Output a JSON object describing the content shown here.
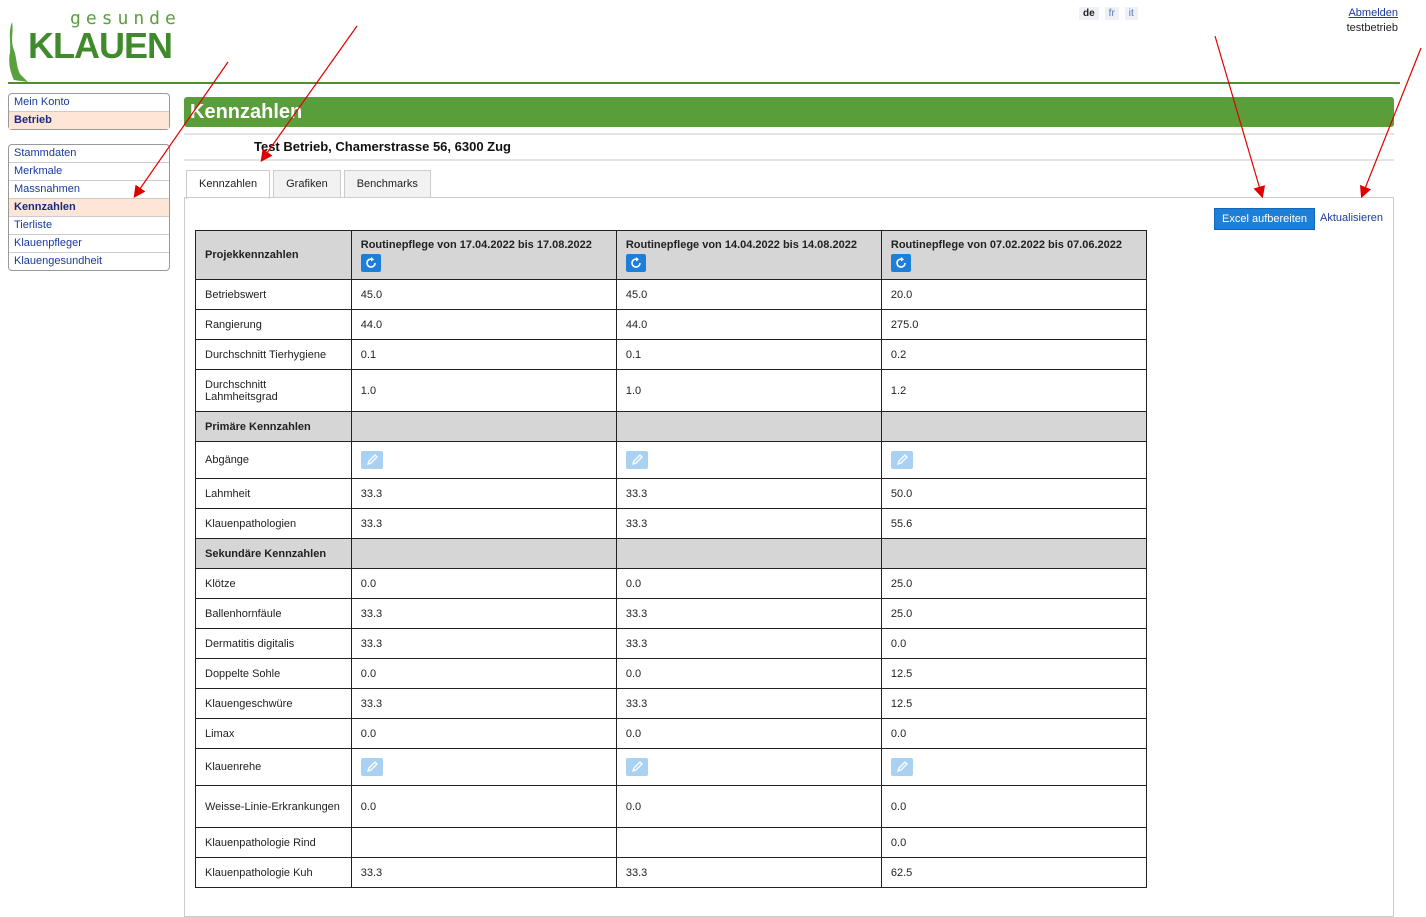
{
  "logo": {
    "top": "gesunde",
    "main": "KLAUEN"
  },
  "languages": [
    {
      "code": "de",
      "active": true
    },
    {
      "code": "fr",
      "active": false
    },
    {
      "code": "it",
      "active": false
    }
  ],
  "user": {
    "logout": "Abmelden",
    "name": "testbetrieb"
  },
  "sidebar": {
    "top": [
      {
        "label": "Mein Konto",
        "selected": false
      },
      {
        "label": "Betrieb",
        "selected": true
      }
    ],
    "main": [
      {
        "label": "Stammdaten",
        "selected": false
      },
      {
        "label": "Merkmale",
        "selected": false
      },
      {
        "label": "Massnahmen",
        "selected": false
      },
      {
        "label": "Kennzahlen",
        "selected": true
      },
      {
        "label": "Tierliste",
        "selected": false
      },
      {
        "label": "Klauenpfleger",
        "selected": false
      },
      {
        "label": "Klauengesundheit",
        "selected": false
      }
    ]
  },
  "page": {
    "title": "Kennzahlen",
    "address": "Test Betrieb, Chamerstrasse 56, 6300 Zug"
  },
  "tabs": [
    {
      "label": "Kennzahlen",
      "active": true
    },
    {
      "label": "Grafiken",
      "active": false
    },
    {
      "label": "Benchmarks",
      "active": false
    }
  ],
  "actions": {
    "excel": "Excel aufbereiten",
    "refresh": "Aktualisieren"
  },
  "table": {
    "header": "Projekkennzahlen",
    "columns": [
      "Routinepflege von 17.04.2022 bis 17.08.2022",
      "Routinepflege von 14.04.2022 bis 14.08.2022",
      "Routinepflege von 07.02.2022 bis 07.06.2022"
    ],
    "rows": [
      {
        "label": "Betriebswert",
        "values": [
          "45.0",
          "45.0",
          "20.0"
        ],
        "h": 30
      },
      {
        "label": "Rangierung",
        "values": [
          "44.0",
          "44.0",
          "275.0"
        ],
        "h": 30
      },
      {
        "label": "Durchschnitt Tierhygiene",
        "values": [
          "0.1",
          "0.1",
          "0.2"
        ],
        "h": 30
      },
      {
        "label": "Durchschnitt Lahmheitsgrad",
        "values": [
          "1.0",
          "1.0",
          "1.2"
        ],
        "h": 42
      },
      {
        "label": "Primäre Kennzahlen",
        "section": true,
        "h": 30
      },
      {
        "label": "Abgänge",
        "edit": true,
        "h": 37
      },
      {
        "label": "Lahmheit",
        "values": [
          "33.3",
          "33.3",
          "50.0"
        ],
        "h": 30
      },
      {
        "label": "Klauenpathologien",
        "values": [
          "33.3",
          "33.3",
          "55.6"
        ],
        "h": 30
      },
      {
        "label": "Sekundäre Kennzahlen",
        "section": true,
        "h": 30
      },
      {
        "label": "Klötze",
        "values": [
          "0.0",
          "0.0",
          "25.0"
        ],
        "h": 30
      },
      {
        "label": "Ballenhornfäule",
        "values": [
          "33.3",
          "33.3",
          "25.0"
        ],
        "h": 30
      },
      {
        "label": "Dermatitis digitalis",
        "values": [
          "33.3",
          "33.3",
          "0.0"
        ],
        "h": 30
      },
      {
        "label": "Doppelte Sohle",
        "values": [
          "0.0",
          "0.0",
          "12.5"
        ],
        "h": 30
      },
      {
        "label": "Klauengeschwüre",
        "values": [
          "33.3",
          "33.3",
          "12.5"
        ],
        "h": 30
      },
      {
        "label": "Limax",
        "values": [
          "0.0",
          "0.0",
          "0.0"
        ],
        "h": 30
      },
      {
        "label": "Klauenrehe",
        "edit": true,
        "h": 37
      },
      {
        "label": "Weisse-Linie-Erkrankungen",
        "values": [
          "0.0",
          "0.0",
          "0.0"
        ],
        "h": 42
      },
      {
        "label": "Klauenpathologie Rind",
        "values": [
          "",
          "",
          "0.0"
        ],
        "h": 30
      },
      {
        "label": "Klauenpathologie Kuh",
        "values": [
          "33.3",
          "33.3",
          "62.5"
        ],
        "h": 30
      }
    ]
  },
  "colors": {
    "brand_green": "#5a9e3c",
    "button_blue": "#1e7fd8",
    "selected_bg": "#fde6d6",
    "annotation_red": "#e00000"
  }
}
